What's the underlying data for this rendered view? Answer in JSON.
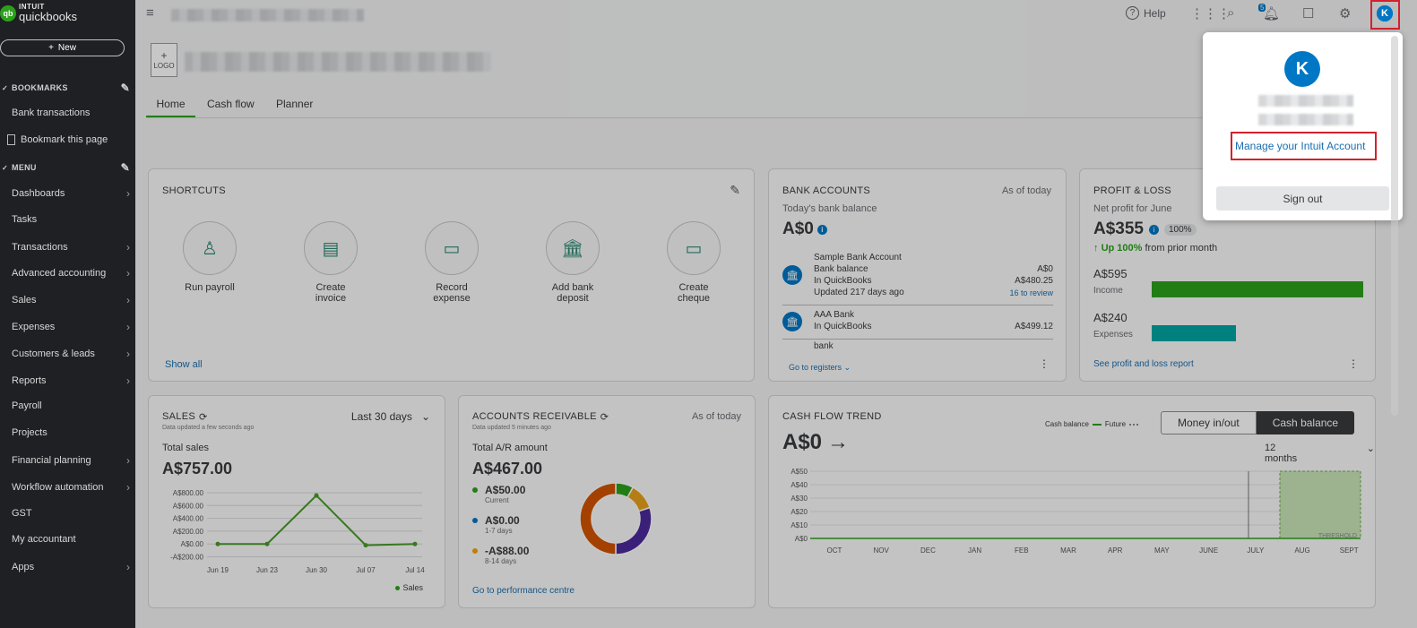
{
  "brand": {
    "intuit": "INTUIT",
    "quickbooks": "quickbooks",
    "logo_mark": "qb"
  },
  "sidebar": {
    "new_label": "New",
    "bookmarks_heading": "BOOKMARKS",
    "bookmarks": [
      "Bank transactions",
      "Bookmark this page"
    ],
    "menu_heading": "MENU",
    "menu": [
      {
        "label": "Dashboards",
        "chev": true
      },
      {
        "label": "Tasks",
        "chev": false
      },
      {
        "label": "Transactions",
        "chev": true
      },
      {
        "label": "Advanced accounting",
        "chev": true
      },
      {
        "label": "Sales",
        "chev": true
      },
      {
        "label": "Expenses",
        "chev": true
      },
      {
        "label": "Customers & leads",
        "chev": true
      },
      {
        "label": "Reports",
        "chev": true
      },
      {
        "label": "Payroll",
        "chev": false
      },
      {
        "label": "Projects",
        "chev": false
      },
      {
        "label": "Financial planning",
        "chev": true
      },
      {
        "label": "Workflow automation",
        "chev": true
      },
      {
        "label": "GST",
        "chev": false
      },
      {
        "label": "My accountant",
        "chev": false
      },
      {
        "label": "Apps",
        "chev": true
      }
    ]
  },
  "topbar": {
    "help": "Help",
    "notification_count": "5",
    "avatar_initial": "K"
  },
  "company": {
    "logo_plus": "+",
    "logo_label": "LOGO"
  },
  "tabs": [
    "Home",
    "Cash flow",
    "Planner"
  ],
  "shortcuts": {
    "title": "SHORTCUTS",
    "items": [
      [
        "Run payroll",
        ""
      ],
      [
        "Create",
        "invoice"
      ],
      [
        "Record",
        "expense"
      ],
      [
        "Add bank",
        "deposit"
      ],
      [
        "Create",
        "cheque"
      ]
    ],
    "show_all": "Show all"
  },
  "bank": {
    "title": "BANK ACCOUNTS",
    "as_of": "As of today",
    "subtitle": "Today's bank balance",
    "total": "A$0",
    "acct1": {
      "name": "Sample Bank Account",
      "bank_balance_label": "Bank balance",
      "bank_balance": "A$0",
      "qb_label": "In QuickBooks",
      "qb_value": "A$480.25",
      "updated": "Updated 217 days ago",
      "review": "16 to review"
    },
    "acct2": {
      "name": "AAA Bank",
      "qb_label": "In QuickBooks",
      "qb_value": "A$499.12"
    },
    "acct3": {
      "name": "bank"
    },
    "go": "Go to registers"
  },
  "pl": {
    "title": "PROFIT & LOSS",
    "subtitle": "Net profit for June",
    "net": "A$355",
    "pct": "100%",
    "up": "Up 100%",
    "up_rest": "from prior month",
    "income": "A$595",
    "income_label": "Income",
    "income_frac": 1.0,
    "expenses": "A$240",
    "expenses_label": "Expenses",
    "expenses_frac": 0.4,
    "link": "See profit and loss report"
  },
  "sales": {
    "title": "SALES",
    "updated": "Data updated a few seconds ago",
    "range": "Last 30 days",
    "total_label": "Total sales",
    "total": "A$757.00",
    "legend": "Sales"
  },
  "ar": {
    "title": "ACCOUNTS RECEIVABLE",
    "as_of": "As of today",
    "updated": "Data updated 5 minutes ago",
    "total_label": "Total A/R amount",
    "total": "A$467.00",
    "items": [
      {
        "amount": "A$50.00",
        "label": "Current",
        "color": "#2ca01c"
      },
      {
        "amount": "A$0.00",
        "label": "1-7 days",
        "color": "#0077c5"
      },
      {
        "amount": "-A$88.00",
        "label": "8-14 days",
        "color": "#f2a500"
      }
    ],
    "link": "Go to performance centre"
  },
  "cash": {
    "title": "CASH FLOW TREND",
    "value": "A$0",
    "legend_balance": "Cash balance",
    "legend_future": "Future",
    "btn_money": "Money in/out",
    "btn_balance": "Cash balance",
    "period": "12 months",
    "threshold": "THRESHOLD"
  },
  "popup": {
    "initial": "K",
    "manage": "Manage your Intuit Account",
    "signout": "Sign out"
  },
  "chart_data": [
    {
      "type": "line",
      "title": "SALES",
      "categories": [
        "Jun 19",
        "Jun 23",
        "Jun 30",
        "Jul 07",
        "Jul 14"
      ],
      "series": [
        {
          "name": "Sales",
          "values": [
            0,
            0,
            757,
            -20,
            0
          ]
        }
      ],
      "yticks": [
        "A$800.00",
        "A$600.00",
        "A$400.00",
        "A$200.00",
        "A$0.00",
        "-A$200.00"
      ],
      "ylim": [
        -200,
        800
      ]
    },
    {
      "type": "pie",
      "title": "ACCOUNTS RECEIVABLE",
      "slices": [
        {
          "label": "segment",
          "color": "#2ca01c",
          "value": 8
        },
        {
          "label": "segment",
          "color": "#e8a21c",
          "value": 12
        },
        {
          "label": "segment",
          "color": "#4b2a9a",
          "value": 30
        },
        {
          "label": "segment",
          "color": "#d35400",
          "value": 50
        }
      ]
    },
    {
      "type": "area",
      "title": "CASH FLOW TREND",
      "categories": [
        "OCT",
        "NOV",
        "DEC",
        "JAN",
        "FEB",
        "MAR",
        "APR",
        "MAY",
        "JUNE",
        "JULY",
        "AUG",
        "SEPT"
      ],
      "yticks": [
        "A$50",
        "A$40",
        "A$30",
        "A$20",
        "A$10",
        "A$0"
      ],
      "ylim": [
        0,
        50
      ],
      "series": [
        {
          "name": "Cash balance",
          "values": [
            0,
            0,
            0,
            0,
            0,
            0,
            0,
            0,
            0,
            0,
            0,
            0
          ]
        }
      ]
    }
  ]
}
